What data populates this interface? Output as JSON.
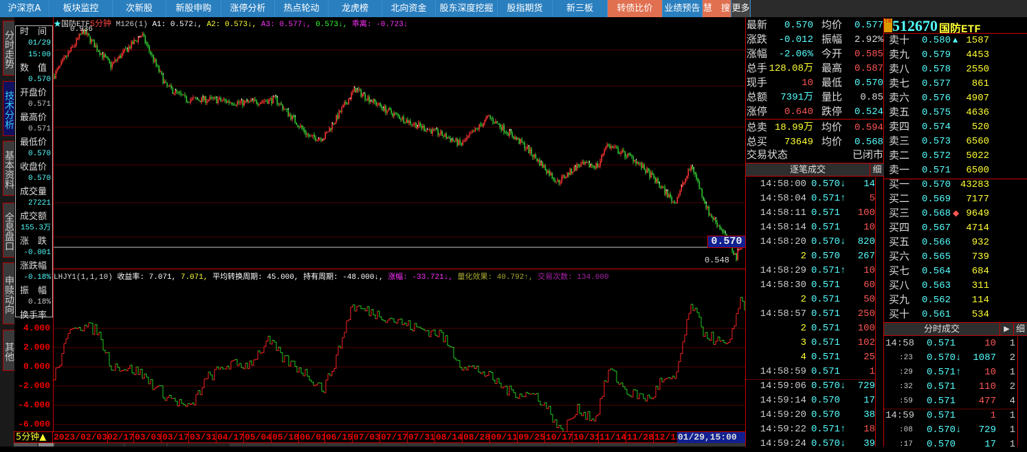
{
  "nav": [
    {
      "label": "沪深京A",
      "w": 72
    },
    {
      "label": "板块监控",
      "w": 92
    },
    {
      "label": "次新股",
      "w": 78
    },
    {
      "label": "新股申购",
      "w": 80
    },
    {
      "label": "涨停分析",
      "w": 78
    },
    {
      "label": "热点轮动",
      "w": 78
    },
    {
      "label": "龙虎榜",
      "w": 78
    },
    {
      "label": "北向资金",
      "w": 78
    },
    {
      "label": "股东深度挖掘",
      "w": 90
    },
    {
      "label": "股指期货",
      "w": 80
    },
    {
      "label": "新三板",
      "w": 80
    },
    {
      "label": "转债比价",
      "w": 80,
      "hot": true
    },
    {
      "label": "业绩预告",
      "w": 58
    },
    {
      "label": "慧　搜",
      "w": 42,
      "hot": true
    },
    {
      "label": "更多",
      "w": 28,
      "gray": true
    }
  ],
  "left_tabs": [
    "分时走势",
    "技术分析",
    "基本资料",
    "全息盘口",
    "申赎动向",
    "其他"
  ],
  "info": [
    [
      "时　间",
      "01/29",
      "15:00"
    ],
    [
      "数　值",
      "0.570"
    ],
    [
      "开盘价",
      "0.571"
    ],
    [
      "最高价",
      "0.571"
    ],
    [
      "最低价",
      "0.570"
    ],
    [
      "收盘价",
      "0.570"
    ],
    [
      "成交量",
      "27221"
    ],
    [
      "成交额",
      "155.3万"
    ],
    [
      "涨　跌",
      "-0.001"
    ],
    [
      "涨跌幅",
      "-0.18%"
    ],
    [
      "振　幅",
      "0.18%"
    ],
    [
      "换手率"
    ]
  ],
  "main_header": {
    "star": "★",
    "name": "国防ETF",
    "period": "5分钟",
    "ma": "M126(1)",
    "a1": "A1: 0.572↓,",
    "a2": "A2: 0.573↓,",
    "a3": "A3: 0.577↓,",
    "a4": "0.573↓,",
    "bias": "乖离: -0.723↓",
    "high_label": "0.936",
    "low_label": "0.548",
    "last_price": "0.570"
  },
  "ind_header": {
    "name": "LHJY1(1,1,10)",
    "p1": "收益率: 7.071,",
    "p2": "7.071,",
    "p3": "平均转换周期: 45.000, 持有周期: -48.000↓,",
    "p4": "涨幅: -33.721↓,",
    "p5": "量化效果: 40.792↑,",
    "p6": "交易次数: 134.000"
  },
  "ind_yticks": [
    "4.000",
    "2.000",
    "0.000",
    "-2.000",
    "-4.000",
    "-6.000"
  ],
  "period_label": "5分钟▲",
  "date_ticks": [
    "2023/02/03",
    "02/17",
    "03/03",
    "03/17",
    "03/31",
    "04/17",
    "05/04",
    "05/18",
    "06/01",
    "06/15",
    "07/03",
    "07/17",
    "07/31",
    "08/14",
    "08/28",
    "09/11",
    "09/25",
    "10/17",
    "10/31",
    "11/14",
    "11/28",
    "12/12"
  ],
  "cursor_date": "01/29,15:00",
  "chart_data": {
    "type": "candlestick",
    "price_knots": [
      [
        0,
        0.858
      ],
      [
        43,
        0.936
      ],
      [
        83,
        0.876
      ],
      [
        128,
        0.93
      ],
      [
        163,
        0.841
      ],
      [
        193,
        0.817
      ],
      [
        233,
        0.817
      ],
      [
        273,
        0.811
      ],
      [
        323,
        0.817
      ],
      [
        373,
        0.751
      ],
      [
        393,
        0.751
      ],
      [
        438,
        0.835
      ],
      [
        483,
        0.799
      ],
      [
        523,
        0.775
      ],
      [
        563,
        0.757
      ],
      [
        593,
        0.739
      ],
      [
        633,
        0.787
      ],
      [
        683,
        0.739
      ],
      [
        733,
        0.674
      ],
      [
        763,
        0.703
      ],
      [
        793,
        0.703
      ],
      [
        803,
        0.739
      ],
      [
        843,
        0.715
      ],
      [
        873,
        0.68
      ],
      [
        903,
        0.638
      ],
      [
        928,
        0.703
      ],
      [
        953,
        0.62
      ],
      [
        973,
        0.59
      ],
      [
        993,
        0.543
      ],
      [
        1000,
        0.57
      ]
    ],
    "indicator_knots": [
      [
        0,
        0.3
      ],
      [
        28,
        6.0
      ],
      [
        63,
        5.3
      ],
      [
        83,
        1.7
      ],
      [
        123,
        1.0
      ],
      [
        163,
        -1.5
      ],
      [
        198,
        -2.9
      ],
      [
        223,
        0.3
      ],
      [
        253,
        1.7
      ],
      [
        283,
        1.7
      ],
      [
        313,
        4.2
      ],
      [
        333,
        2.4
      ],
      [
        363,
        1.0
      ],
      [
        393,
        -0.8
      ],
      [
        413,
        2.8
      ],
      [
        433,
        7.8
      ],
      [
        483,
        6.7
      ],
      [
        523,
        5.6
      ],
      [
        563,
        4.9
      ],
      [
        593,
        1.7
      ],
      [
        623,
        1.0
      ],
      [
        663,
        -1.1
      ],
      [
        703,
        -1.5
      ],
      [
        723,
        -3.3
      ],
      [
        738,
        -5.4
      ],
      [
        763,
        -2.9
      ],
      [
        788,
        -4.0
      ],
      [
        808,
        1.3
      ],
      [
        833,
        -1.1
      ],
      [
        868,
        -1.9
      ],
      [
        883,
        0
      ],
      [
        903,
        0
      ],
      [
        928,
        8.1
      ],
      [
        943,
        5.3
      ],
      [
        963,
        4.2
      ],
      [
        983,
        3.5
      ],
      [
        998,
        8.8
      ],
      [
        1005,
        7.4
      ]
    ],
    "price_range": [
      0.531,
      0.96
    ],
    "indicator_range": [
      -6.8,
      10.2
    ]
  },
  "quote": [
    [
      "最新",
      "0.570",
      "c",
      "均价",
      "0.577",
      "c"
    ],
    [
      "涨跌",
      "-0.012",
      "c",
      "振幅",
      "2.92%",
      "w"
    ],
    [
      "涨幅",
      "-2.06%",
      "c",
      "今开",
      "0.585",
      "r"
    ],
    [
      "总手",
      "128.08万",
      "y",
      "最高",
      "0.587",
      "r"
    ],
    [
      "现手",
      "10",
      "r",
      "最低",
      "0.570",
      "c"
    ],
    [
      "总额",
      "7391万",
      "c",
      "量比",
      "0.85",
      "w"
    ],
    [
      "涨停",
      "0.640",
      "r",
      "跌停",
      "0.524",
      "c"
    ],
    [
      "总卖",
      "18.99万",
      "y",
      "均价",
      "0.594",
      "r"
    ],
    [
      "总买",
      "73649",
      "y",
      "均价",
      "0.568",
      "c"
    ]
  ],
  "trade_status": {
    "label": "交易状态",
    "value": "已闭市"
  },
  "tick_title": "逐笔成交",
  "detail": "细",
  "ticks": [
    [
      "14:58:00",
      "0.570↓",
      "14",
      "c"
    ],
    [
      "14:58:04",
      "0.571↑",
      "5",
      "r"
    ],
    [
      "14:58:11",
      "0.571",
      "100",
      "r"
    ],
    [
      "14:58:14",
      "0.571",
      "10",
      "r"
    ],
    [
      "14:58:20",
      "0.570↓",
      "820",
      "c"
    ],
    [
      "2",
      "0.570",
      "267",
      "c"
    ],
    [
      "14:58:29",
      "0.571↑",
      "10",
      "r"
    ],
    [
      "14:58:30",
      "0.571",
      "60",
      "r"
    ],
    [
      "2",
      "0.571",
      "50",
      "r"
    ],
    [
      "14:58:57",
      "0.571",
      "250",
      "r"
    ],
    [
      "2",
      "0.571",
      "100",
      "r"
    ],
    [
      "3",
      "0.571",
      "102",
      "r"
    ],
    [
      "4",
      "0.571",
      "25",
      "r"
    ],
    [
      "14:58:59",
      "0.571",
      "1",
      "r"
    ],
    [
      "14:59:06",
      "0.570↓",
      "729",
      "c"
    ],
    [
      "14:59:14",
      "0.570",
      "17",
      "c"
    ],
    [
      "14:59:20",
      "0.570",
      "38",
      "c"
    ],
    [
      "14:59:22",
      "0.571↑",
      "18",
      "r"
    ],
    [
      "14:59:24",
      "0.570↓",
      "39",
      "c"
    ]
  ],
  "stock": {
    "tag": "TR",
    "code": "512670",
    "name": "国防ETF"
  },
  "asks": [
    [
      "卖十",
      "0.580",
      "1587",
      "▲"
    ],
    [
      "卖九",
      "0.579",
      "4453"
    ],
    [
      "卖八",
      "0.578",
      "2550"
    ],
    [
      "卖七",
      "0.577",
      "861"
    ],
    [
      "卖六",
      "0.576",
      "4907"
    ],
    [
      "卖五",
      "0.575",
      "4636"
    ],
    [
      "卖四",
      "0.574",
      "520"
    ],
    [
      "卖三",
      "0.573",
      "6560"
    ],
    [
      "卖二",
      "0.572",
      "5022"
    ],
    [
      "卖一",
      "0.571",
      "6500"
    ]
  ],
  "bids": [
    [
      "买一",
      "0.570",
      "43283"
    ],
    [
      "买二",
      "0.569",
      "7177"
    ],
    [
      "买三",
      "0.568",
      "9649",
      "◆"
    ],
    [
      "买四",
      "0.567",
      "4714"
    ],
    [
      "买五",
      "0.566",
      "932"
    ],
    [
      "买六",
      "0.565",
      "739"
    ],
    [
      "买七",
      "0.564",
      "684"
    ],
    [
      "买八",
      "0.563",
      "311"
    ],
    [
      "买九",
      "0.562",
      "114"
    ],
    [
      "买十",
      "0.561",
      "534"
    ]
  ],
  "minute_title": "分时成交",
  "minute_arrow": "▶",
  "minute_trades": [
    [
      "14:58",
      "0.571",
      "10",
      "1",
      "r"
    ],
    [
      ":23",
      "0.570↓",
      "1087",
      "2",
      "c"
    ],
    [
      ":29",
      "0.571↑",
      "10",
      "1",
      "r"
    ],
    [
      ":32",
      "0.571",
      "110",
      "2",
      "r"
    ],
    [
      ":59",
      "0.571",
      "477",
      "4",
      "r"
    ],
    [
      "14:59",
      "0.571",
      "1",
      "1",
      "r"
    ],
    [
      ":08",
      "0.570↓",
      "729",
      "1",
      "c"
    ],
    [
      ":17",
      "0.570",
      "17",
      "1",
      "c"
    ]
  ]
}
